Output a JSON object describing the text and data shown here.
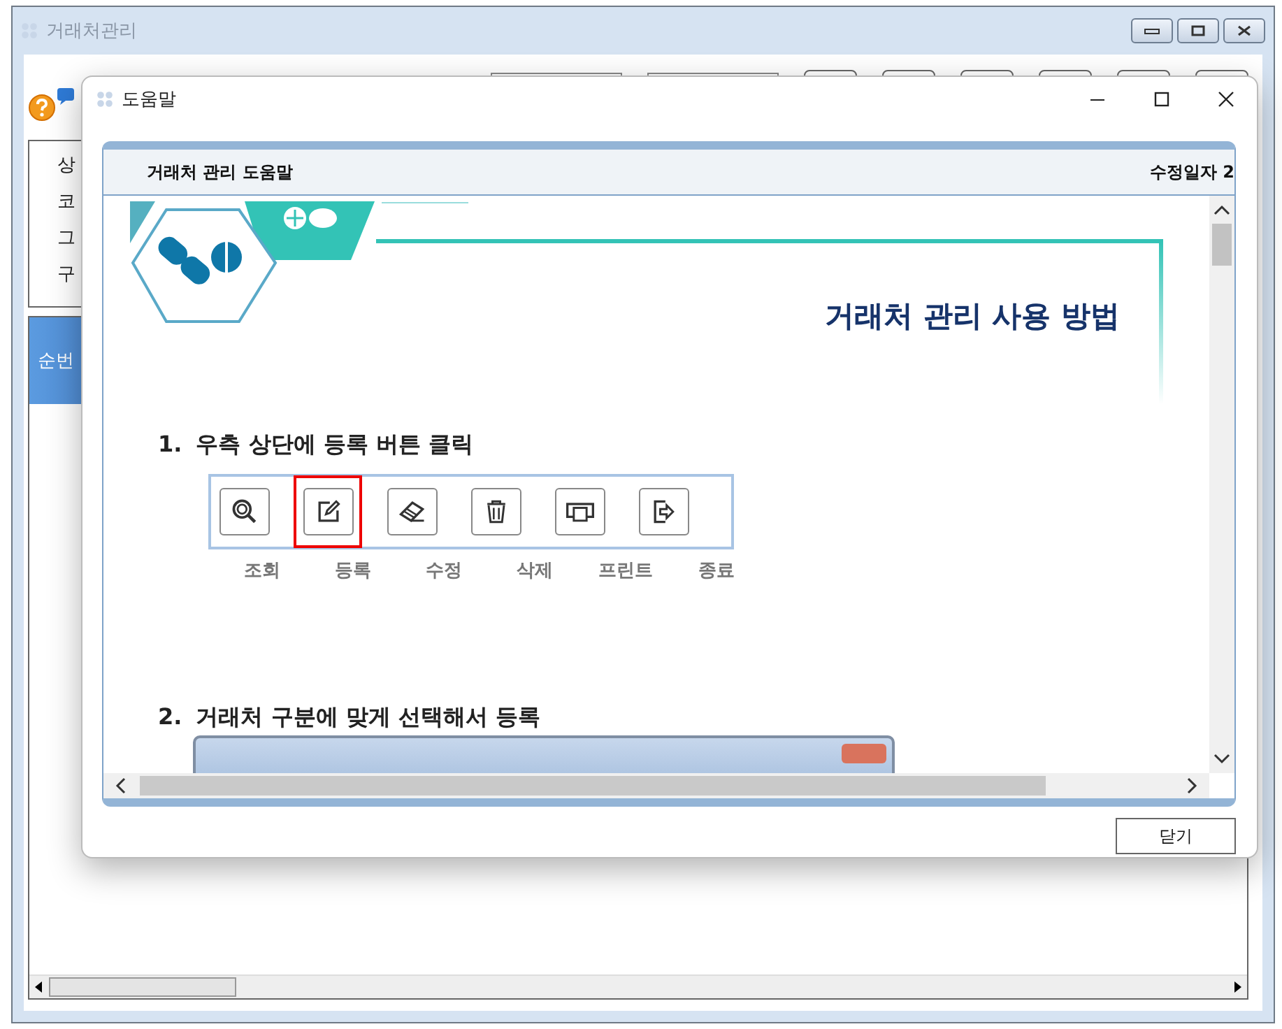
{
  "background_window": {
    "title": "거래처관리",
    "form_labels": [
      "상",
      "코",
      "그",
      "구"
    ],
    "grid_header": "순번"
  },
  "dialog": {
    "title": "도움말",
    "doc_header": {
      "title": "거래처 관리 도움말",
      "date_label": "수정일자 2"
    },
    "heading": "거래처 관리 사용 방법",
    "steps": [
      {
        "number": "1.",
        "text": "우측 상단에 등록 버튼 클릭",
        "toolbar": [
          {
            "label": "조회",
            "kind": "search",
            "selected": false
          },
          {
            "label": "등록",
            "kind": "edit",
            "selected": true
          },
          {
            "label": "수정",
            "kind": "eraser",
            "selected": false
          },
          {
            "label": "삭제",
            "kind": "trash",
            "selected": false
          },
          {
            "label": "프린트",
            "kind": "print",
            "selected": false
          },
          {
            "label": "종료",
            "kind": "exit",
            "selected": false
          }
        ]
      },
      {
        "number": "2.",
        "text": "거래처 구분에 맞게 선택해서 등록"
      }
    ],
    "close_button": "닫기"
  }
}
